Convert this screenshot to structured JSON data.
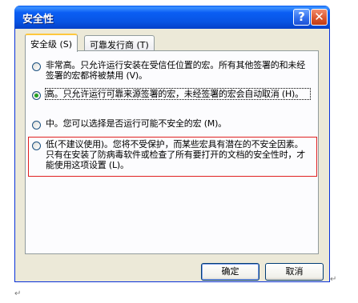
{
  "window": {
    "title": "安全性",
    "help_symbol": "?",
    "close_symbol": "✕"
  },
  "tabs": [
    {
      "label": "安全级 (S)"
    },
    {
      "label": "可靠发行商 (T)"
    }
  ],
  "options": [
    {
      "label": "非常高。只允许运行安装在受信任位置的宏。所有其他签署的和未经签署的宏都将被禁用 (V)。",
      "selected": false
    },
    {
      "label": "高。只允许运行可靠来源签署的宏，未经签署的宏会自动取消 (H)。",
      "selected": true
    },
    {
      "label": "中。您可以选择是否运行可能不安全的宏 (M)。",
      "selected": false
    },
    {
      "label": "低(不建议使用)。您将不受保护，而某些宏具有潜在的不安全因素。只有在安装了防病毒软件或检查了所有要打开的文档的安全性时，才能使用这项设置 (L)。",
      "selected": false
    }
  ],
  "buttons": {
    "ok": "确定",
    "cancel": "取消"
  },
  "marks": {
    "paragraph": "↵"
  },
  "colors": {
    "titlebar": "#0a5ef4",
    "highlight_border": "#e02020",
    "selected_dot": "#21a121"
  }
}
